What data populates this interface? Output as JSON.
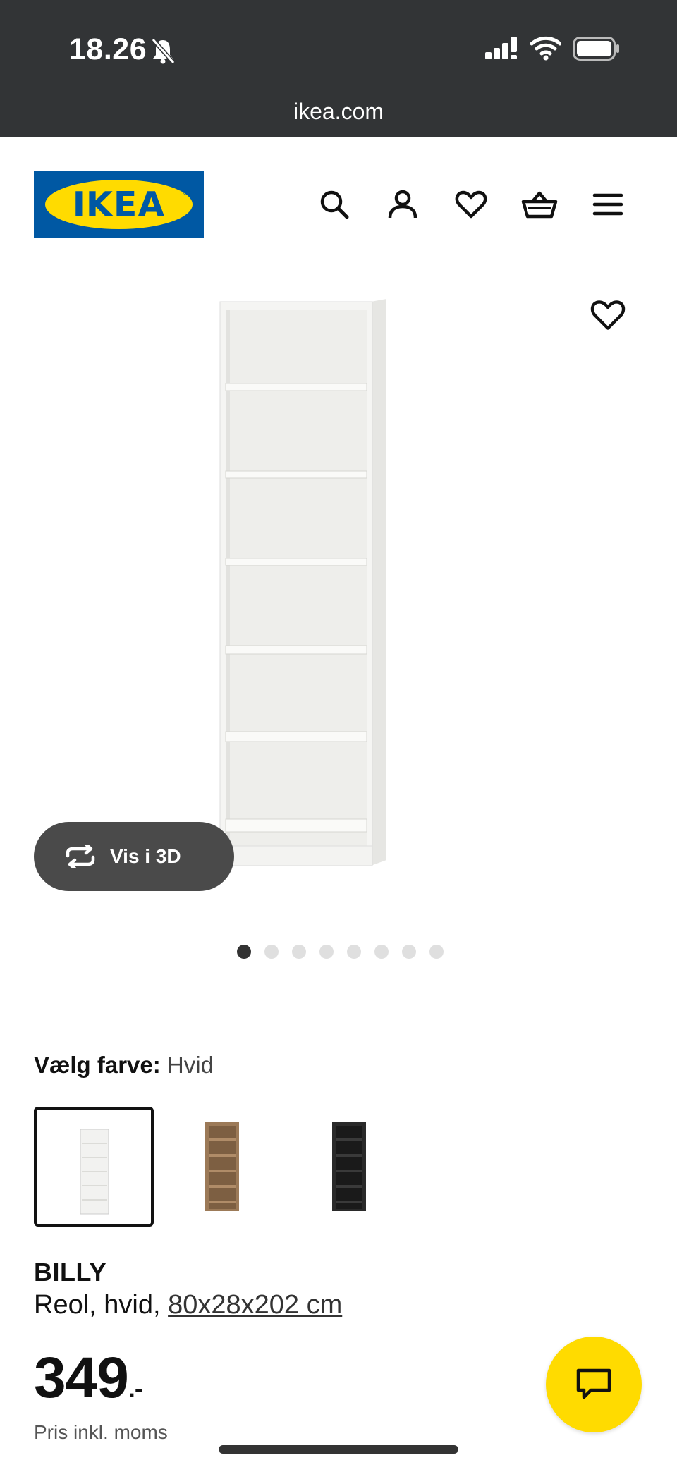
{
  "status_bar": {
    "time": "18.26",
    "url": "ikea.com"
  },
  "brand": {
    "logo_text": "IKEA",
    "primary": "#0058a3",
    "yellow": "#ffdb00"
  },
  "header_icons": [
    "search-icon",
    "account-icon",
    "heart-icon",
    "basket-icon",
    "menu-icon"
  ],
  "gallery": {
    "view_3d_label": "Vis i 3D",
    "image_count": 8,
    "active_index": 0
  },
  "color_picker": {
    "label": "Vælg farve:",
    "selected": "Hvid",
    "options": [
      {
        "color": "#f4f4f2",
        "selected": true
      },
      {
        "color": "#9c7a58",
        "selected": false
      },
      {
        "color": "#2a2a2a",
        "selected": false
      }
    ]
  },
  "product": {
    "name": "BILLY",
    "description_prefix": "Reol, hvid, ",
    "dimensions": "80x28x202 cm",
    "price": "349",
    "price_suffix": ".-",
    "price_note": "Pris inkl. moms"
  }
}
